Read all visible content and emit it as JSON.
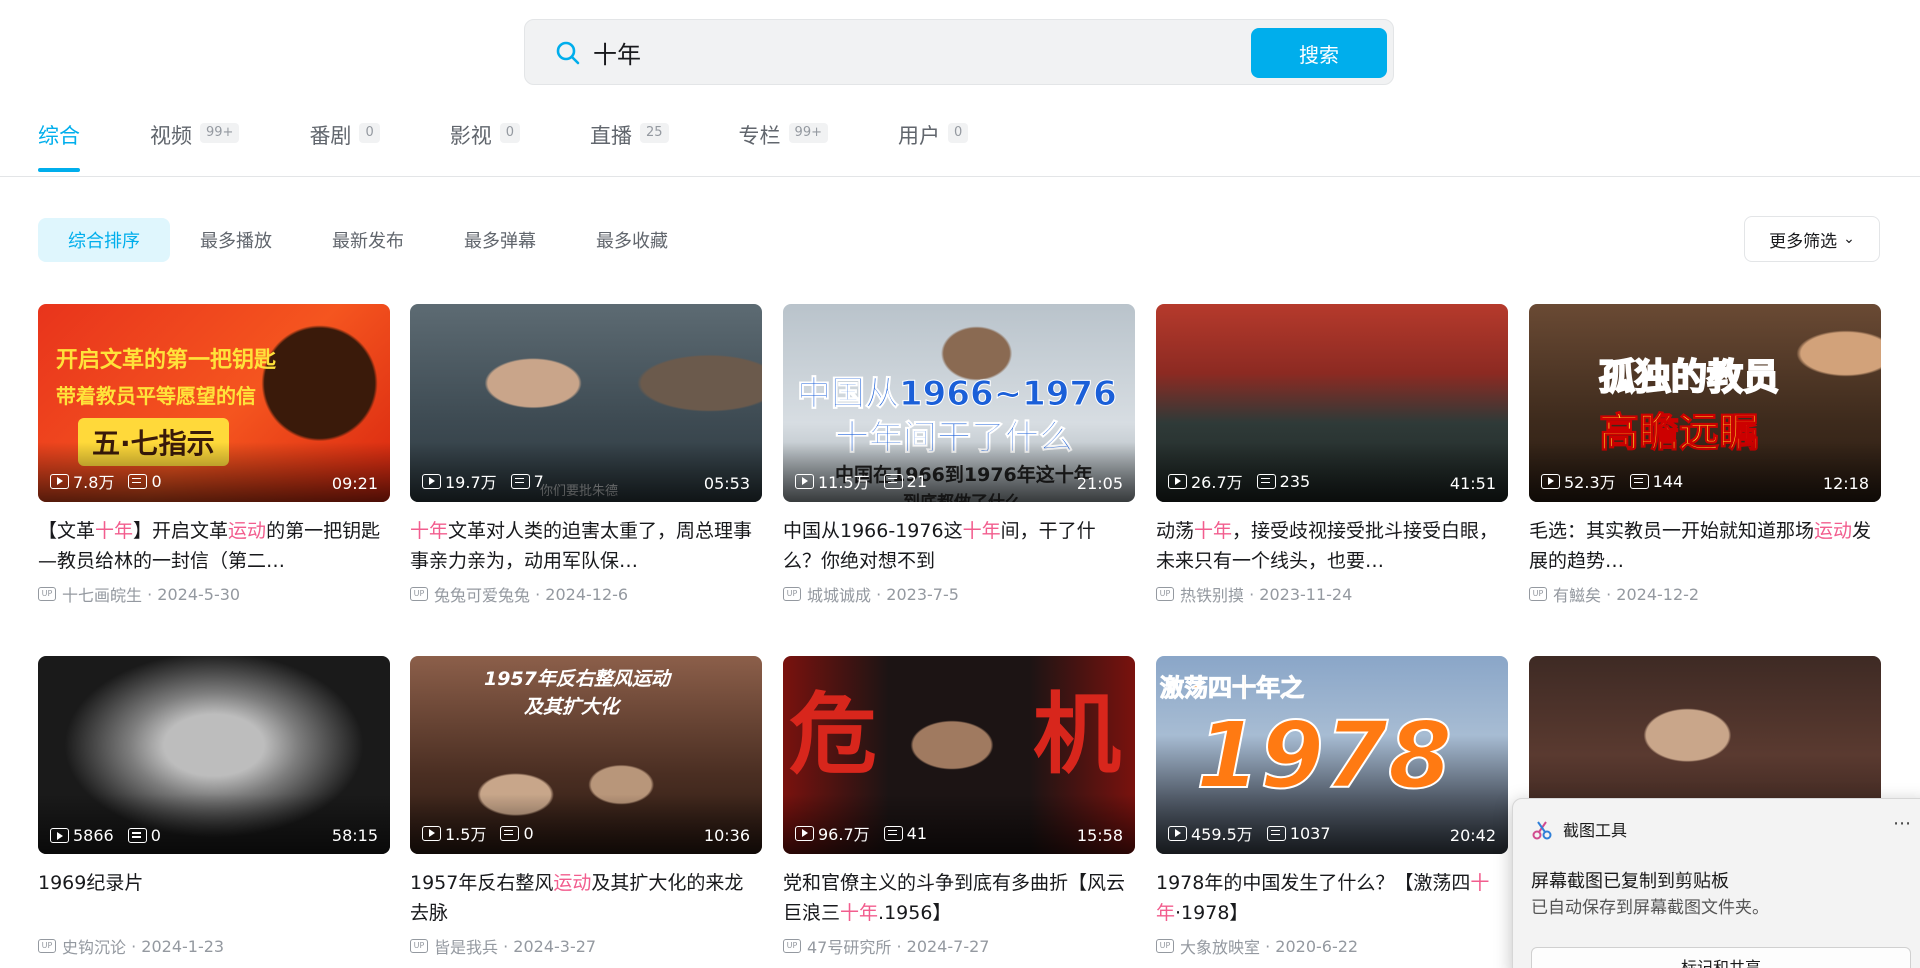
{
  "search": {
    "value": "十年",
    "button_label": "搜索"
  },
  "tabs": [
    {
      "label": "综合",
      "count": ""
    },
    {
      "label": "视频",
      "count": "99+"
    },
    {
      "label": "番剧",
      "count": "0"
    },
    {
      "label": "影视",
      "count": "0"
    },
    {
      "label": "直播",
      "count": "25"
    },
    {
      "label": "专栏",
      "count": "99+"
    },
    {
      "label": "用户",
      "count": "0"
    }
  ],
  "sort": [
    "综合排序",
    "最多播放",
    "最新发布",
    "最多弹幕",
    "最多收藏"
  ],
  "more_filter": "更多筛选",
  "videos": [
    {
      "plays": "7.8万",
      "danmaku": "0",
      "duration": "09:21",
      "title_parts": [
        [
          "【文革",
          ""
        ],
        [
          "十年",
          "hl"
        ],
        [
          "】开启文革",
          ""
        ],
        [
          "运动",
          "hl"
        ],
        [
          "的第一把钥匙—教员给林的一封信（第二…",
          ""
        ]
      ],
      "uploader": "十七画皖生",
      "date": "2024-5-30",
      "overlay": [
        "开启文革的第一把钥匙",
        "带着教员平等愿望的信",
        "五·七指示"
      ]
    },
    {
      "plays": "19.7万",
      "danmaku": "7",
      "duration": "05:53",
      "title_parts": [
        [
          "十年",
          "hl"
        ],
        [
          "文革对人类的迫害太重了，周总理事事亲力亲为，动用军队保…",
          ""
        ]
      ],
      "uploader": "兔兔可爱兔兔",
      "date": "2024-12-6",
      "overlay": [
        "你们要批朱德"
      ]
    },
    {
      "plays": "11.5万",
      "danmaku": "21",
      "duration": "21:05",
      "title_parts": [
        [
          "中国从1966-1976这",
          ""
        ],
        [
          "十年",
          "hl"
        ],
        [
          "间，干了什么？你绝对想不到",
          ""
        ]
      ],
      "uploader": "城城诚成",
      "date": "2023-7-5",
      "overlay": [
        "中国从1966~1976",
        "十年间干了什么",
        "中国在1966到1976年这十年",
        "到底都做了什么"
      ]
    },
    {
      "plays": "26.7万",
      "danmaku": "235",
      "duration": "41:51",
      "title_parts": [
        [
          "动荡",
          ""
        ],
        [
          "十年",
          "hl"
        ],
        [
          "，接受歧视接受批斗接受白眼，未来只有一个线头，也要…",
          ""
        ]
      ],
      "uploader": "热铁别摸",
      "date": "2023-11-24",
      "overlay": []
    },
    {
      "plays": "52.3万",
      "danmaku": "144",
      "duration": "12:18",
      "title_parts": [
        [
          "毛选：其实教员一开始就知道那场",
          ""
        ],
        [
          "运动",
          "hl"
        ],
        [
          "发展的趋势…",
          ""
        ]
      ],
      "uploader": "有鰦矣",
      "date": "2024-12-2",
      "overlay": [
        "孤独的教员",
        "高瞻远瞩"
      ]
    },
    {
      "plays": "5866",
      "danmaku": "0",
      "duration": "58:15",
      "title_parts": [
        [
          "1969纪录片",
          ""
        ]
      ],
      "uploader": "史钩沉论",
      "date": "2024-1-23",
      "overlay": []
    },
    {
      "plays": "1.5万",
      "danmaku": "0",
      "duration": "10:36",
      "title_parts": [
        [
          "1957年反右整风",
          ""
        ],
        [
          "运动",
          "hl"
        ],
        [
          "及其扩大化的来龙去脉",
          ""
        ]
      ],
      "uploader": "皆是我兵",
      "date": "2024-3-27",
      "overlay": [
        "1957年反右整风运动",
        "及其扩大化"
      ]
    },
    {
      "plays": "96.7万",
      "danmaku": "41",
      "duration": "15:58",
      "title_parts": [
        [
          "党和官僚主义的斗争到底有多曲折【风云巨浪三",
          ""
        ],
        [
          "十年",
          "hl"
        ],
        [
          ".1956】",
          ""
        ]
      ],
      "uploader": "47号研究所",
      "date": "2024-7-27",
      "overlay": [
        "危",
        "机"
      ]
    },
    {
      "plays": "459.5万",
      "danmaku": "1037",
      "duration": "20:42",
      "title_parts": [
        [
          "1978年的中国发生了什么？【激荡四",
          ""
        ],
        [
          "十年",
          "hl"
        ],
        [
          "·1978】",
          ""
        ]
      ],
      "uploader": "大象放映室",
      "date": "2020-6-22",
      "overlay": [
        "激荡四十年之",
        "1978"
      ]
    },
    {
      "plays": "",
      "danmaku": "",
      "duration": "",
      "title_parts": [],
      "uploader": "",
      "date": "",
      "overlay": []
    }
  ],
  "snip": {
    "app": "截图工具",
    "line1": "屏幕截图已复制到剪贴板",
    "line2": "已自动保存到屏幕截图文件夹。",
    "button": "标记和共享"
  },
  "colors": {
    "accent": "#00aeec",
    "highlight": "#f25d8e"
  }
}
